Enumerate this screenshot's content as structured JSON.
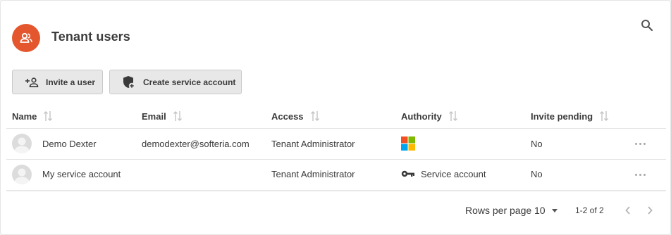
{
  "header": {
    "title": "Tenant users",
    "avatar_icon": "users-icon",
    "avatar_color": "#e4572e",
    "search_icon": "search-icon"
  },
  "toolbar": {
    "invite_label": "Invite a user",
    "invite_icon": "person-add-icon",
    "service_label": "Create service account",
    "service_icon": "shield-add-icon"
  },
  "table": {
    "columns": [
      "Name",
      "Email",
      "Access",
      "Authority",
      "Invite pending"
    ],
    "rows": [
      {
        "name": "Demo Dexter",
        "email": "demodexter@softeria.com",
        "access": "Tenant Administrator",
        "authority_icon": "microsoft-logo-icon",
        "authority_text": "",
        "invite_pending": "No"
      },
      {
        "name": "My service account",
        "email": "",
        "access": "Tenant Administrator",
        "authority_icon": "key-icon",
        "authority_text": "Service account",
        "invite_pending": "No"
      }
    ]
  },
  "pagination": {
    "rows_per_page_label": "Rows per page",
    "rows_per_page_value": "10",
    "range_text": "1-2 of 2"
  }
}
